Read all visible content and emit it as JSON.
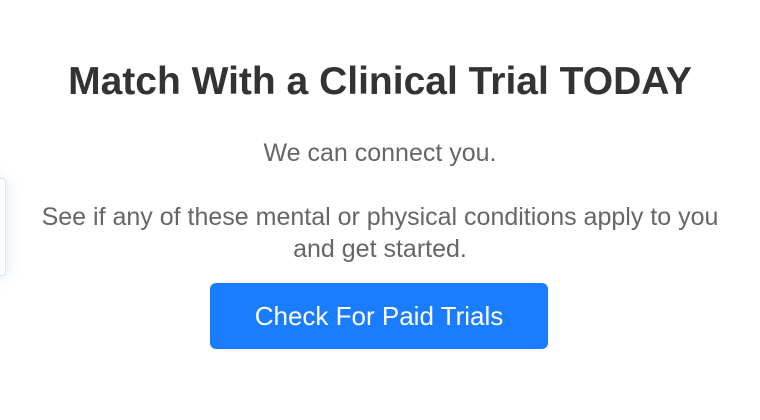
{
  "hero": {
    "headline": "Match With a Clinical Trial TODAY",
    "subtitle": "We can connect you.",
    "description": "See if any of these mental or physical conditions apply to you and get started.",
    "cta_label": "Check For Paid Trials"
  },
  "colors": {
    "button_background": "#1a7dff",
    "button_text": "#ffffff",
    "headline_text": "#333333",
    "body_text": "#666666"
  }
}
